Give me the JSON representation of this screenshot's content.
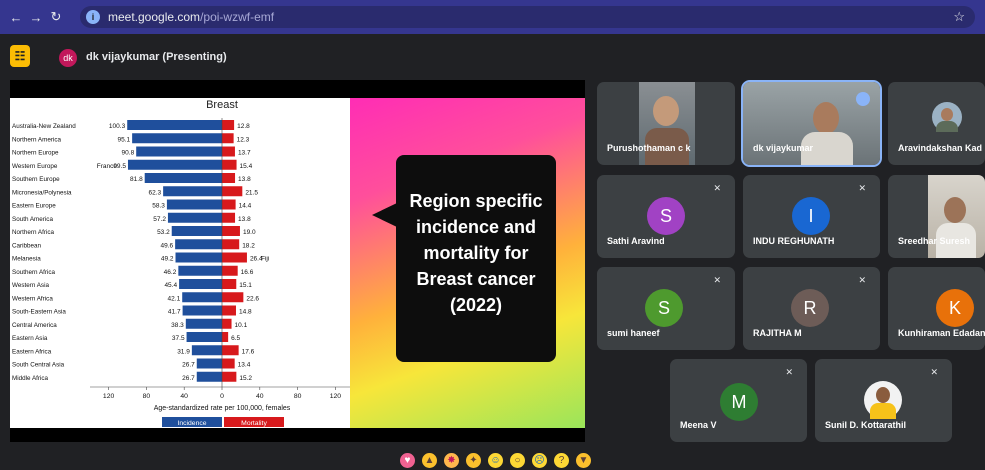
{
  "browser": {
    "url_host": "meet.google.com",
    "url_path": "/poi-wzwf-emf"
  },
  "meeting": {
    "presenter_initials": "dk",
    "presenter_label": "dk vijaykumar (Presenting)"
  },
  "slide": {
    "callout_lines": [
      "Region specific",
      "incidence and",
      "mortality for",
      "Breast cancer",
      "(2022)"
    ]
  },
  "chart_data": {
    "type": "bar",
    "title": "Breast",
    "xlabel": "Age-standardized rate per 100,000, females",
    "xlim": [
      -120,
      120
    ],
    "xticks": [
      "120",
      "80",
      "40",
      "0",
      "40",
      "80",
      "120"
    ],
    "categories": [
      "Australia-New Zealand",
      "Northern America",
      "Northern Europe",
      "Western Europe",
      "Southern Europe",
      "Micronesia/Polynesia",
      "Eastern Europe",
      "South America",
      "Northern Africa",
      "Caribbean",
      "Melanesia",
      "Southern Africa",
      "Western Asia",
      "Western Africa",
      "South-Eastern Asia",
      "Central America",
      "Eastern Asia",
      "Eastern Africa",
      "South Central Asia",
      "Middle Africa"
    ],
    "series": [
      {
        "name": "Incidence",
        "color": "#1f4f9c",
        "values": [
          100.3,
          95.1,
          90.8,
          99.5,
          81.8,
          62.3,
          58.3,
          57.2,
          53.2,
          49.6,
          49.2,
          46.2,
          45.4,
          42.1,
          41.7,
          38.3,
          37.5,
          31.9,
          26.7,
          26.7
        ]
      },
      {
        "name": "Mortality",
        "color": "#d7191c",
        "values": [
          12.8,
          12.3,
          13.7,
          15.4,
          13.8,
          21.5,
          14.4,
          13.8,
          19.0,
          18.2,
          26.4,
          16.6,
          15.1,
          22.6,
          14.8,
          10.1,
          6.5,
          17.6,
          13.4,
          15.2
        ]
      }
    ],
    "annotations": [
      {
        "category": "Western Europe",
        "side": "left",
        "text": "France"
      },
      {
        "category": "Melanesia",
        "side": "right",
        "text": "Fiji"
      }
    ],
    "legend_position": "bottom"
  },
  "participants": [
    {
      "name": "Purushothaman c k",
      "type": "photo"
    },
    {
      "name": "dk vijaykumar",
      "type": "photo",
      "speaking": true
    },
    {
      "name": "Aravindakshan Kad",
      "type": "photo"
    },
    {
      "name": "Sathi Aravind",
      "initial": "S",
      "color": "#a142c4",
      "muted": true
    },
    {
      "name": "INDU REGHUNATH",
      "initial": "I",
      "color": "#1967d2",
      "muted": true
    },
    {
      "name": "Sreedhar Suresh",
      "type": "photo"
    },
    {
      "name": "sumi haneef",
      "initial": "S",
      "color": "#4e9a2e",
      "muted": true
    },
    {
      "name": "RAJITHA M",
      "initial": "R",
      "color": "#6d5c57",
      "muted": true
    },
    {
      "name": "Kunhiraman Edadan",
      "initial": "K",
      "color": "#e8710a"
    },
    {
      "name": "Meena V",
      "initial": "M",
      "color": "#2e7d32",
      "muted": true
    },
    {
      "name": "Sunil D. Kottarathil",
      "type": "photo",
      "muted": true
    }
  ],
  "reactions": [
    "sparkling-heart",
    "thumbs-up",
    "party-popper",
    "clapping-hands",
    "tears-of-joy",
    "surprised-face",
    "crying-face",
    "thinking-face",
    "thumbs-down"
  ]
}
